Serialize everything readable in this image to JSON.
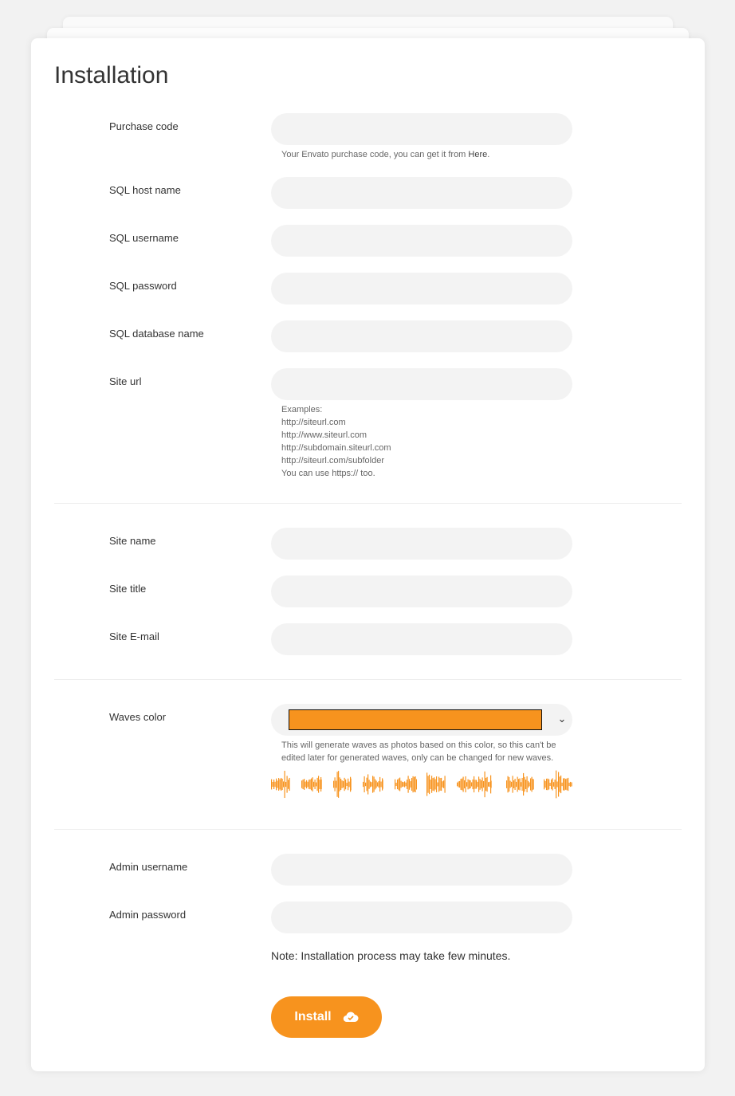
{
  "title": "Installation",
  "section1": {
    "purchase_code": {
      "label": "Purchase code",
      "value": "",
      "help": "Your Envato purchase code, you can get it from ",
      "help_link": "Here",
      "help_end": "."
    },
    "sql_host": {
      "label": "SQL host name",
      "value": ""
    },
    "sql_user": {
      "label": "SQL username",
      "value": ""
    },
    "sql_pass": {
      "label": "SQL password",
      "value": ""
    },
    "sql_db": {
      "label": "SQL database name",
      "value": ""
    },
    "site_url": {
      "label": "Site url",
      "value": "",
      "help": [
        "Examples:",
        "http://siteurl.com",
        "http://www.siteurl.com",
        "http://subdomain.siteurl.com",
        "http://siteurl.com/subfolder",
        "You can use https:// too."
      ]
    }
  },
  "section2": {
    "site_name": {
      "label": "Site name",
      "value": ""
    },
    "site_title": {
      "label": "Site title",
      "value": ""
    },
    "site_email": {
      "label": "Site E-mail",
      "value": ""
    }
  },
  "section3": {
    "waves_color": {
      "label": "Waves color",
      "selected_color": "#f7931e",
      "help": "This will generate waves as photos based on this color, so this can't be edited later for generated waves, only can be changed for new waves.",
      "preview_count": 9
    }
  },
  "section4": {
    "admin_user": {
      "label": "Admin username",
      "value": ""
    },
    "admin_pass": {
      "label": "Admin password",
      "value": ""
    },
    "note": "Note: Installation process may take few minutes.",
    "install_label": "Install",
    "install_icon": "cloud-check-icon"
  },
  "colors": {
    "accent": "#f7931e",
    "input_bg": "#f3f3f3"
  }
}
